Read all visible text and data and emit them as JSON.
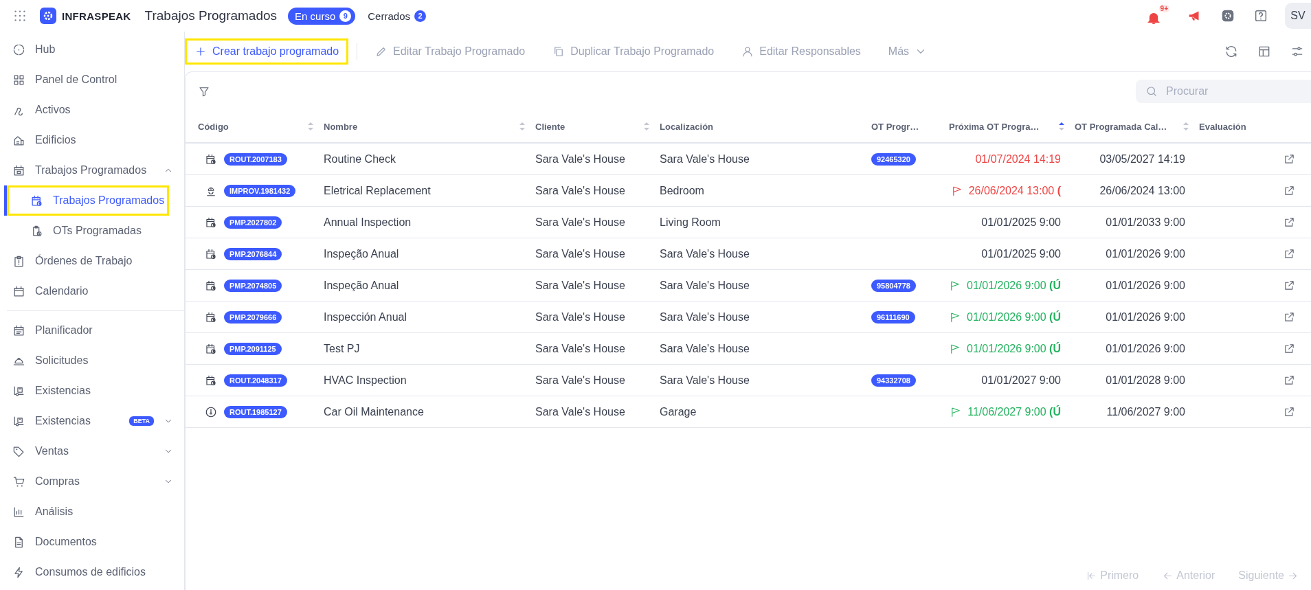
{
  "top_bar": {
    "brand": "INFRASPEAK",
    "title": "Trabajos Programados",
    "tabs": [
      {
        "label": "En curso",
        "count": "9",
        "selected": true
      },
      {
        "label": "Cerrados",
        "count": "2",
        "selected": false
      }
    ],
    "notifications_badge": "9+",
    "avatar": "SV"
  },
  "sidebar": {
    "sections": [
      {
        "items": [
          {
            "label": "Hub",
            "kind": "hub",
            "selected": false
          },
          {
            "label": "Panel de Control",
            "kind": "dashboard",
            "selected": false
          },
          {
            "label": "Activos",
            "kind": "assets",
            "selected": false
          },
          {
            "label": "Edificios",
            "kind": "buildings",
            "selected": false
          },
          {
            "label": "Trabajos Programados",
            "kind": "calendar-box",
            "selected": false,
            "expanded": true,
            "children": [
              {
                "label": "Trabajos Programados",
                "kind": "calendar-clock",
                "selected": true,
                "highlighted": true
              },
              {
                "label": "OTs Programadas",
                "kind": "clipboard-clock",
                "selected": false,
                "highlighted": false
              }
            ]
          },
          {
            "label": "Órdenes de Trabajo",
            "kind": "workorders",
            "selected": false
          },
          {
            "label": "Calendario",
            "kind": "calendar",
            "selected": false
          }
        ]
      },
      {
        "items": [
          {
            "label": "Planificador",
            "kind": "planner",
            "selected": false
          },
          {
            "label": "Solicitudes",
            "kind": "requests",
            "selected": false
          },
          {
            "label": "Existencias",
            "kind": "stock",
            "selected": false
          },
          {
            "label": "Existencias",
            "kind": "stock",
            "selected": false,
            "badge": "BETA",
            "expanded": false
          },
          {
            "label": "Ventas",
            "kind": "tag",
            "selected": false,
            "expanded": false
          },
          {
            "label": "Compras",
            "kind": "cart",
            "selected": false,
            "expanded": false
          },
          {
            "label": "Análisis",
            "kind": "analysis",
            "selected": false
          },
          {
            "label": "Documentos",
            "kind": "documents",
            "selected": false
          },
          {
            "label": "Consumos de edificios",
            "kind": "energy",
            "selected": false
          }
        ]
      }
    ]
  },
  "toolbar": {
    "actions": [
      {
        "label": "Crear trabajo programado",
        "kind": "plus",
        "disabled": false,
        "highlighted": true
      },
      {
        "label": "Editar Trabajo Programado",
        "kind": "pencil",
        "disabled": true,
        "highlighted": false
      },
      {
        "label": "Duplicar Trabajo Programado",
        "kind": "copy",
        "disabled": true,
        "highlighted": false
      },
      {
        "label": "Editar Responsables",
        "kind": "user",
        "disabled": true,
        "highlighted": false
      },
      {
        "label": "Más",
        "kind": "menu",
        "disabled": true,
        "highlighted": false
      }
    ]
  },
  "search": {
    "placeholder": "Procurar"
  },
  "table": {
    "columns": [
      {
        "label": "Código",
        "sorted": false
      },
      {
        "label": "Nombre",
        "sorted": false
      },
      {
        "label": "Cliente",
        "sorted": false
      },
      {
        "label": "Localización"
      },
      {
        "label": "OT Progr…"
      },
      {
        "label": "Próxima OT Progra…",
        "sorted": true
      },
      {
        "label": "OT Programada Cal…",
        "sorted": false
      },
      {
        "label": "Evaluación"
      }
    ],
    "rows": [
      {
        "kind": "calendar-clock",
        "code": "ROUT.2007183",
        "name": "Routine Check",
        "client": "Sara Vale's House",
        "location": "Sara Vale's House",
        "ot": "92465320",
        "next": {
          "text": "01/07/2024 14:19",
          "kind": "late",
          "flag": false
        },
        "calc": "03/05/2027 14:19"
      },
      {
        "kind": "worker",
        "code": "IMPROV.1981432",
        "name": "Eletrical Replacement",
        "client": "Sara Vale's House",
        "location": "Bedroom",
        "next": {
          "text": "26/06/2024 13:00 **(**",
          "kind": "late",
          "flag": true
        },
        "calc": "26/06/2024 13:00"
      },
      {
        "kind": "calendar-clock",
        "code": "PMP.2027802",
        "name": "Annual Inspection",
        "client": "Sara Vale's House",
        "location": "Living Room",
        "next": {
          "text": "01/01/2025 9:00",
          "kind": "normal",
          "flag": false
        },
        "calc": "01/01/2033 9:00"
      },
      {
        "kind": "calendar-clock",
        "code": "PMP.2076844",
        "name": "Inspeção Anual",
        "client": "Sara Vale's House",
        "location": "Sara Vale's House",
        "next": {
          "text": "01/01/2025 9:00",
          "kind": "normal",
          "flag": false
        },
        "calc": "01/01/2026 9:00"
      },
      {
        "kind": "calendar-clock",
        "code": "PMP.2074805",
        "name": "Inspeção Anual",
        "client": "Sara Vale's House",
        "location": "Sara Vale's House",
        "ot": "95804778",
        "next": {
          "text": "01/01/2026 9:00 **(Ú**",
          "kind": "ok",
          "flag": true
        },
        "calc": "01/01/2026 9:00"
      },
      {
        "kind": "calendar-clock",
        "code": "PMP.2079666",
        "name": "Inspección Anual",
        "client": "Sara Vale's House",
        "location": "Sara Vale's House",
        "ot": "96111690",
        "next": {
          "text": "01/01/2026 9:00 **(Ú**",
          "kind": "ok",
          "flag": true
        },
        "calc": "01/01/2026 9:00"
      },
      {
        "kind": "calendar-clock",
        "code": "PMP.2091125",
        "name": "Test PJ",
        "client": "Sara Vale's House",
        "location": "Sara Vale's House",
        "next": {
          "text": "01/01/2026 9:00 **(Ú**",
          "kind": "ok",
          "flag": true
        },
        "calc": "01/01/2026 9:00"
      },
      {
        "kind": "calendar-clock",
        "code": "ROUT.2048317",
        "name": "HVAC Inspection",
        "client": "Sara Vale's House",
        "location": "Sara Vale's House",
        "ot": "94332708",
        "next": {
          "text": "01/01/2027 9:00",
          "kind": "normal",
          "flag": false
        },
        "calc": "01/01/2028 9:00"
      },
      {
        "kind": "gauge",
        "code": "ROUT.1985127",
        "name": "Car Oil Maintenance",
        "client": "Sara Vale's House",
        "location": "Garage",
        "next": {
          "text": "11/06/2027 9:00 **(Ú**",
          "kind": "ok",
          "flag": true
        },
        "calc": "11/06/2027 9:00"
      }
    ]
  },
  "pagination": [
    {
      "label": "Primero",
      "kind": "first",
      "disabled": true
    },
    {
      "label": "Anterior",
      "kind": "prev",
      "disabled": true
    },
    {
      "label": "Siguiente",
      "kind": "next",
      "disabled": true
    }
  ]
}
